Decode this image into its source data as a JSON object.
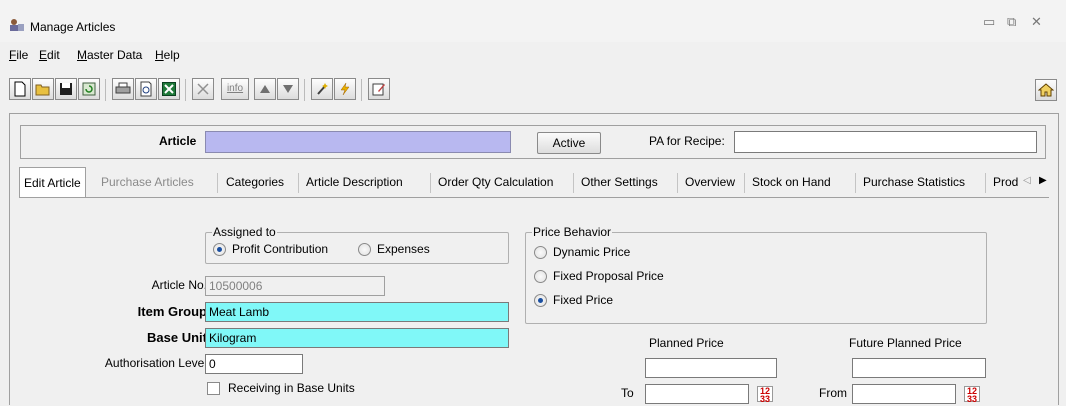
{
  "window": {
    "title": "Manage Articles",
    "minimize": "▭",
    "restore": "⧉",
    "close": "✕"
  },
  "menu": {
    "file": "ile",
    "file_u": "F",
    "edit": "dit",
    "edit_u": "E",
    "master": "aster Data",
    "master_u": "M",
    "help": "elp",
    "help_u": "H"
  },
  "toolbar": {
    "icons": [
      "new-document",
      "open-folder",
      "save",
      "refresh",
      "print",
      "print-preview",
      "excel-export",
      "delete",
      "info",
      "move-up",
      "move-down",
      "wand",
      "lightning",
      "edit-note",
      "home"
    ],
    "info_label": "info"
  },
  "header": {
    "article_label": "Article",
    "article_value": "",
    "active_button": "Active",
    "pa_recipe_label": "PA for Recipe:",
    "pa_recipe_value": ""
  },
  "tabs": [
    {
      "label": "Edit Article",
      "active": true
    },
    {
      "label": "Purchase Articles",
      "disabled": true
    },
    {
      "label": "Categories"
    },
    {
      "label": "Article Description"
    },
    {
      "label": "Order Qty Calculation"
    },
    {
      "label": "Other Settings"
    },
    {
      "label": "Overview"
    },
    {
      "label": "Stock on Hand"
    },
    {
      "label": "Purchase Statistics"
    },
    {
      "label": "Prod"
    }
  ],
  "tab_scroll": {
    "left": "◁",
    "right": "▶"
  },
  "assigned_to": {
    "title": "Assigned to",
    "options": [
      {
        "label": "Profit Contribution",
        "selected": true
      },
      {
        "label": "Expenses",
        "selected": false
      }
    ]
  },
  "price_behavior": {
    "title": "Price Behavior",
    "options": [
      {
        "label": "Dynamic Price",
        "selected": false
      },
      {
        "label": "Fixed Proposal Price",
        "selected": false
      },
      {
        "label": "Fixed Price",
        "selected": true
      }
    ]
  },
  "fields": {
    "article_no_label": "Article No.",
    "article_no_value": "10500006",
    "item_group_label": "Item Group",
    "item_group_value": "Meat Lamb",
    "base_unit_label": "Base Unit",
    "base_unit_value": "Kilogram",
    "auth_level_label": "Authorisation Level",
    "auth_level_value": "0",
    "receiving_label": "Receiving in Base Units"
  },
  "pricing": {
    "planned_price_label": "Planned Price",
    "planned_price_value": "",
    "future_planned_label": "Future Planned Price",
    "future_planned_value": "",
    "to_label": "To",
    "to_value": "",
    "from_label": "From",
    "from_value": "",
    "calendar_glyph": "12\n33"
  },
  "colors": {
    "highlight_input": "#80f8f8",
    "article_input": "#b8b8f0",
    "accent": "#1a4fa0"
  }
}
